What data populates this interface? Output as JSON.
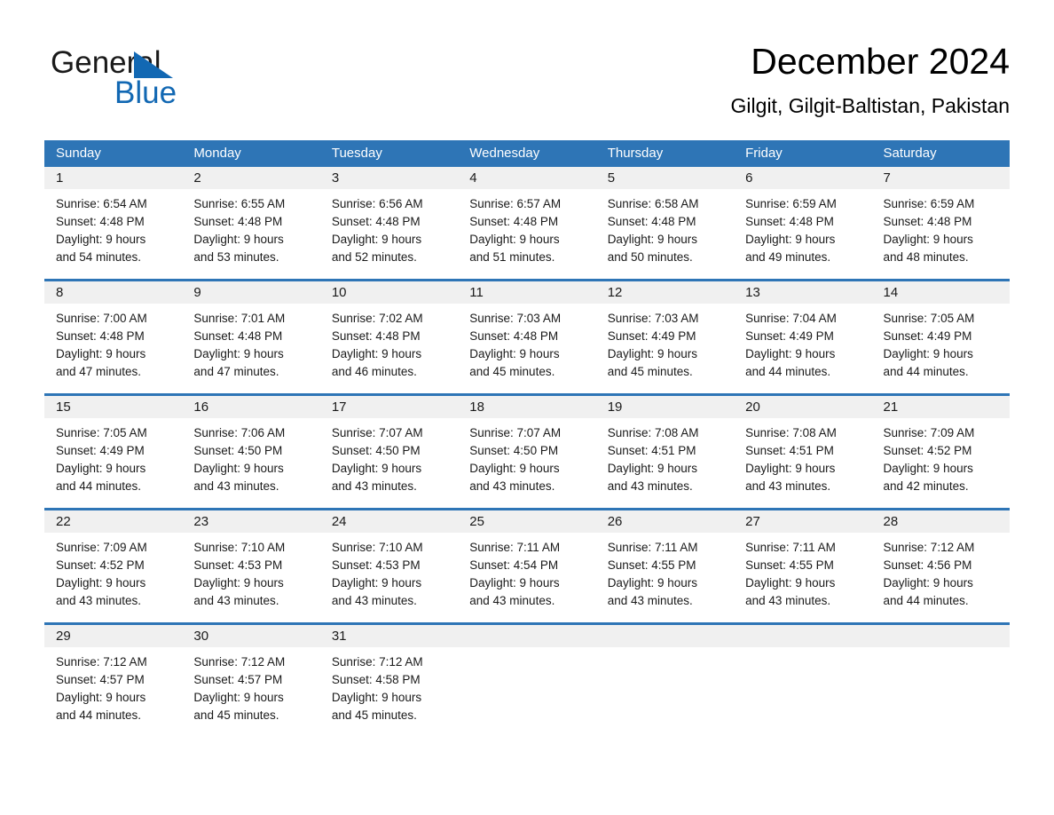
{
  "brand": {
    "name_part1": "General",
    "name_part2": "Blue",
    "accent_color": "#1268b3",
    "triangle_icon": "triangle-logo-icon"
  },
  "header": {
    "title": "December 2024",
    "location": "Gilgit, Gilgit-Baltistan, Pakistan"
  },
  "theme": {
    "header_blue": "#2e75b6",
    "daynum_band": "#f0f0f0",
    "separator_blue": "#2e75b6"
  },
  "weekdays": [
    "Sunday",
    "Monday",
    "Tuesday",
    "Wednesday",
    "Thursday",
    "Friday",
    "Saturday"
  ],
  "weeks": [
    {
      "days": [
        {
          "num": "1",
          "sunrise": "Sunrise: 6:54 AM",
          "sunset": "Sunset: 4:48 PM",
          "daylight1": "Daylight: 9 hours",
          "daylight2": "and 54 minutes."
        },
        {
          "num": "2",
          "sunrise": "Sunrise: 6:55 AM",
          "sunset": "Sunset: 4:48 PM",
          "daylight1": "Daylight: 9 hours",
          "daylight2": "and 53 minutes."
        },
        {
          "num": "3",
          "sunrise": "Sunrise: 6:56 AM",
          "sunset": "Sunset: 4:48 PM",
          "daylight1": "Daylight: 9 hours",
          "daylight2": "and 52 minutes."
        },
        {
          "num": "4",
          "sunrise": "Sunrise: 6:57 AM",
          "sunset": "Sunset: 4:48 PM",
          "daylight1": "Daylight: 9 hours",
          "daylight2": "and 51 minutes."
        },
        {
          "num": "5",
          "sunrise": "Sunrise: 6:58 AM",
          "sunset": "Sunset: 4:48 PM",
          "daylight1": "Daylight: 9 hours",
          "daylight2": "and 50 minutes."
        },
        {
          "num": "6",
          "sunrise": "Sunrise: 6:59 AM",
          "sunset": "Sunset: 4:48 PM",
          "daylight1": "Daylight: 9 hours",
          "daylight2": "and 49 minutes."
        },
        {
          "num": "7",
          "sunrise": "Sunrise: 6:59 AM",
          "sunset": "Sunset: 4:48 PM",
          "daylight1": "Daylight: 9 hours",
          "daylight2": "and 48 minutes."
        }
      ]
    },
    {
      "days": [
        {
          "num": "8",
          "sunrise": "Sunrise: 7:00 AM",
          "sunset": "Sunset: 4:48 PM",
          "daylight1": "Daylight: 9 hours",
          "daylight2": "and 47 minutes."
        },
        {
          "num": "9",
          "sunrise": "Sunrise: 7:01 AM",
          "sunset": "Sunset: 4:48 PM",
          "daylight1": "Daylight: 9 hours",
          "daylight2": "and 47 minutes."
        },
        {
          "num": "10",
          "sunrise": "Sunrise: 7:02 AM",
          "sunset": "Sunset: 4:48 PM",
          "daylight1": "Daylight: 9 hours",
          "daylight2": "and 46 minutes."
        },
        {
          "num": "11",
          "sunrise": "Sunrise: 7:03 AM",
          "sunset": "Sunset: 4:48 PM",
          "daylight1": "Daylight: 9 hours",
          "daylight2": "and 45 minutes."
        },
        {
          "num": "12",
          "sunrise": "Sunrise: 7:03 AM",
          "sunset": "Sunset: 4:49 PM",
          "daylight1": "Daylight: 9 hours",
          "daylight2": "and 45 minutes."
        },
        {
          "num": "13",
          "sunrise": "Sunrise: 7:04 AM",
          "sunset": "Sunset: 4:49 PM",
          "daylight1": "Daylight: 9 hours",
          "daylight2": "and 44 minutes."
        },
        {
          "num": "14",
          "sunrise": "Sunrise: 7:05 AM",
          "sunset": "Sunset: 4:49 PM",
          "daylight1": "Daylight: 9 hours",
          "daylight2": "and 44 minutes."
        }
      ]
    },
    {
      "days": [
        {
          "num": "15",
          "sunrise": "Sunrise: 7:05 AM",
          "sunset": "Sunset: 4:49 PM",
          "daylight1": "Daylight: 9 hours",
          "daylight2": "and 44 minutes."
        },
        {
          "num": "16",
          "sunrise": "Sunrise: 7:06 AM",
          "sunset": "Sunset: 4:50 PM",
          "daylight1": "Daylight: 9 hours",
          "daylight2": "and 43 minutes."
        },
        {
          "num": "17",
          "sunrise": "Sunrise: 7:07 AM",
          "sunset": "Sunset: 4:50 PM",
          "daylight1": "Daylight: 9 hours",
          "daylight2": "and 43 minutes."
        },
        {
          "num": "18",
          "sunrise": "Sunrise: 7:07 AM",
          "sunset": "Sunset: 4:50 PM",
          "daylight1": "Daylight: 9 hours",
          "daylight2": "and 43 minutes."
        },
        {
          "num": "19",
          "sunrise": "Sunrise: 7:08 AM",
          "sunset": "Sunset: 4:51 PM",
          "daylight1": "Daylight: 9 hours",
          "daylight2": "and 43 minutes."
        },
        {
          "num": "20",
          "sunrise": "Sunrise: 7:08 AM",
          "sunset": "Sunset: 4:51 PM",
          "daylight1": "Daylight: 9 hours",
          "daylight2": "and 43 minutes."
        },
        {
          "num": "21",
          "sunrise": "Sunrise: 7:09 AM",
          "sunset": "Sunset: 4:52 PM",
          "daylight1": "Daylight: 9 hours",
          "daylight2": "and 42 minutes."
        }
      ]
    },
    {
      "days": [
        {
          "num": "22",
          "sunrise": "Sunrise: 7:09 AM",
          "sunset": "Sunset: 4:52 PM",
          "daylight1": "Daylight: 9 hours",
          "daylight2": "and 43 minutes."
        },
        {
          "num": "23",
          "sunrise": "Sunrise: 7:10 AM",
          "sunset": "Sunset: 4:53 PM",
          "daylight1": "Daylight: 9 hours",
          "daylight2": "and 43 minutes."
        },
        {
          "num": "24",
          "sunrise": "Sunrise: 7:10 AM",
          "sunset": "Sunset: 4:53 PM",
          "daylight1": "Daylight: 9 hours",
          "daylight2": "and 43 minutes."
        },
        {
          "num": "25",
          "sunrise": "Sunrise: 7:11 AM",
          "sunset": "Sunset: 4:54 PM",
          "daylight1": "Daylight: 9 hours",
          "daylight2": "and 43 minutes."
        },
        {
          "num": "26",
          "sunrise": "Sunrise: 7:11 AM",
          "sunset": "Sunset: 4:55 PM",
          "daylight1": "Daylight: 9 hours",
          "daylight2": "and 43 minutes."
        },
        {
          "num": "27",
          "sunrise": "Sunrise: 7:11 AM",
          "sunset": "Sunset: 4:55 PM",
          "daylight1": "Daylight: 9 hours",
          "daylight2": "and 43 minutes."
        },
        {
          "num": "28",
          "sunrise": "Sunrise: 7:12 AM",
          "sunset": "Sunset: 4:56 PM",
          "daylight1": "Daylight: 9 hours",
          "daylight2": "and 44 minutes."
        }
      ]
    },
    {
      "days": [
        {
          "num": "29",
          "sunrise": "Sunrise: 7:12 AM",
          "sunset": "Sunset: 4:57 PM",
          "daylight1": "Daylight: 9 hours",
          "daylight2": "and 44 minutes."
        },
        {
          "num": "30",
          "sunrise": "Sunrise: 7:12 AM",
          "sunset": "Sunset: 4:57 PM",
          "daylight1": "Daylight: 9 hours",
          "daylight2": "and 45 minutes."
        },
        {
          "num": "31",
          "sunrise": "Sunrise: 7:12 AM",
          "sunset": "Sunset: 4:58 PM",
          "daylight1": "Daylight: 9 hours",
          "daylight2": "and 45 minutes."
        },
        {
          "num": "",
          "sunrise": "",
          "sunset": "",
          "daylight1": "",
          "daylight2": ""
        },
        {
          "num": "",
          "sunrise": "",
          "sunset": "",
          "daylight1": "",
          "daylight2": ""
        },
        {
          "num": "",
          "sunrise": "",
          "sunset": "",
          "daylight1": "",
          "daylight2": ""
        },
        {
          "num": "",
          "sunrise": "",
          "sunset": "",
          "daylight1": "",
          "daylight2": ""
        }
      ]
    }
  ]
}
